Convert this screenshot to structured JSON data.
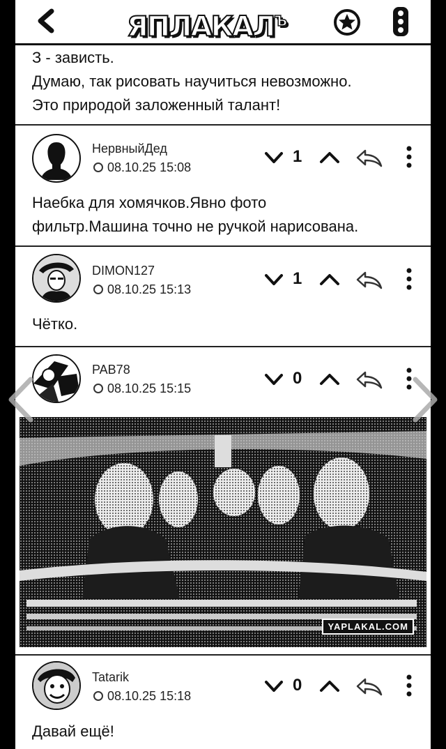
{
  "header": {
    "logo_text": "ЯПЛАКАЛ",
    "logo_sup": "Ъ"
  },
  "top_comment": {
    "lines": [
      "З - зависть.",
      "Думаю, так рисовать научиться невозможно.",
      "Это природой заложенный талант!"
    ]
  },
  "comments": [
    {
      "username": "НервныйДед",
      "timestamp": "08.10.25 15:08",
      "votes": "1",
      "text_lines": [
        "Наебка для хомячков.Явно фото",
        "фильтр.Машина точно не ручкой нарисована."
      ]
    },
    {
      "username": "DIMON127",
      "timestamp": "08.10.25 15:13",
      "votes": "1",
      "text_lines": [
        "Чётко."
      ]
    },
    {
      "username": "PAB78",
      "timestamp": "08.10.25 15:15",
      "votes": "0",
      "image_watermark": "YAPLAKAL.COM"
    },
    {
      "username": "Tatarik",
      "timestamp": "08.10.25 15:18",
      "votes": "0",
      "text_lines": [
        "Давай ещё!"
      ]
    }
  ],
  "colors": {
    "background": "#000000",
    "panel": "#ffffff",
    "ink": "#111111"
  }
}
